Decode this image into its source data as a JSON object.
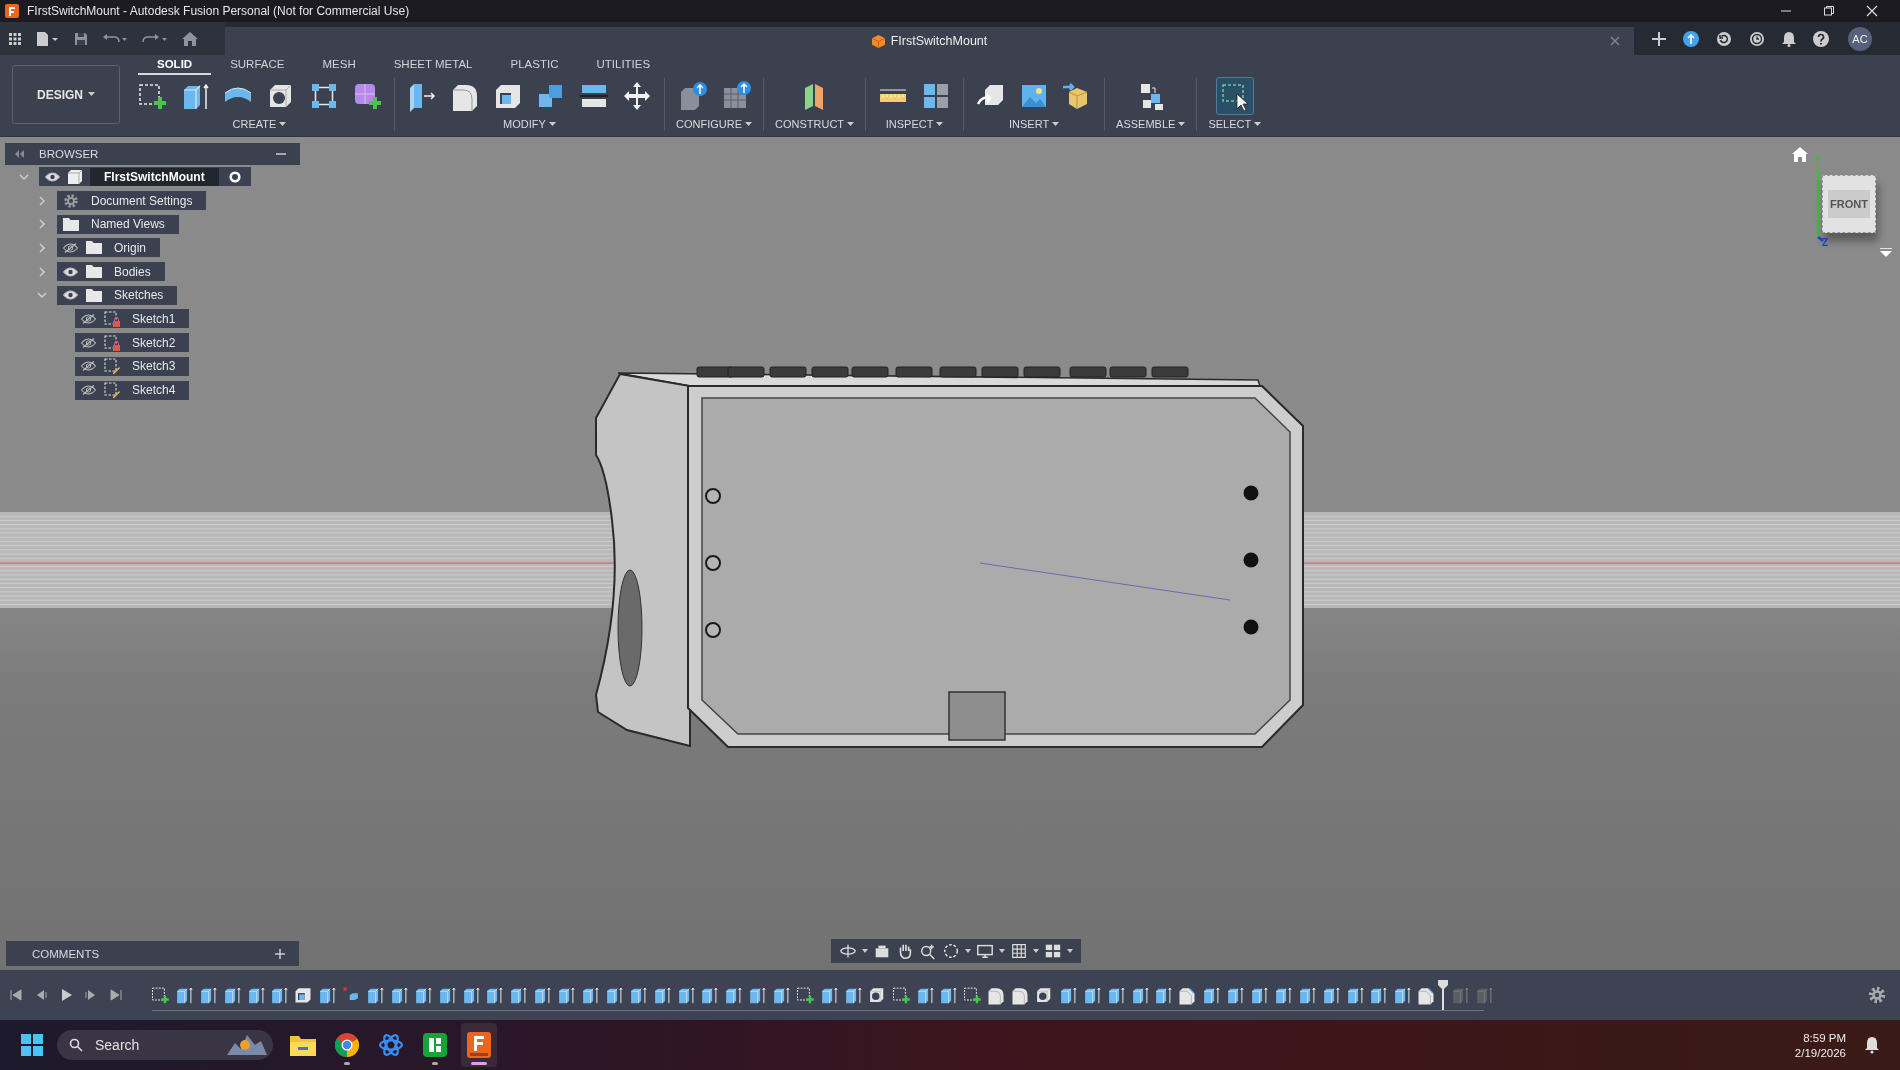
{
  "window": {
    "title": "FIrstSwitchMount - Autodesk Fusion Personal (Not for Commercial Use)"
  },
  "document_tab": {
    "title": "FIrstSwitchMount"
  },
  "account": {
    "initials": "AC"
  },
  "workspace": {
    "label": "DESIGN"
  },
  "tabs": [
    {
      "label": "SOLID",
      "selected": true
    },
    {
      "label": "SURFACE",
      "selected": false
    },
    {
      "label": "MESH",
      "selected": false
    },
    {
      "label": "SHEET METAL",
      "selected": false
    },
    {
      "label": "PLASTIC",
      "selected": false
    },
    {
      "label": "UTILITIES",
      "selected": false
    }
  ],
  "tool_groups": [
    {
      "label": "CREATE",
      "tools": [
        {
          "kind": "sketch",
          "selected": false
        },
        {
          "kind": "extrude",
          "selected": false
        },
        {
          "kind": "revolve",
          "selected": false
        },
        {
          "kind": "hole",
          "selected": false
        },
        {
          "kind": "pattern",
          "selected": false
        },
        {
          "kind": "form",
          "selected": false
        }
      ]
    },
    {
      "label": "MODIFY",
      "tools": [
        {
          "kind": "presspull",
          "selected": false
        },
        {
          "kind": "fillet",
          "selected": false
        },
        {
          "kind": "shell",
          "selected": false
        },
        {
          "kind": "combine",
          "selected": false
        },
        {
          "kind": "split",
          "selected": false
        },
        {
          "kind": "move",
          "selected": false
        }
      ]
    },
    {
      "label": "CONFIGURE",
      "tools": [
        {
          "kind": "parameters",
          "selected": false
        },
        {
          "kind": "table",
          "selected": false
        }
      ]
    },
    {
      "label": "CONSTRUCT",
      "tools": [
        {
          "kind": "plane",
          "selected": false
        }
      ]
    },
    {
      "label": "INSPECT",
      "tools": [
        {
          "kind": "measure",
          "selected": false
        },
        {
          "kind": "interference",
          "selected": false
        }
      ]
    },
    {
      "label": "INSERT",
      "tools": [
        {
          "kind": "derive",
          "selected": false
        },
        {
          "kind": "image",
          "selected": false
        },
        {
          "kind": "mesh",
          "selected": false
        }
      ]
    },
    {
      "label": "ASSEMBLE",
      "tools": [
        {
          "kind": "joint",
          "selected": false
        }
      ]
    },
    {
      "label": "SELECT",
      "tools": [
        {
          "kind": "select",
          "selected": true
        }
      ]
    }
  ],
  "browser": {
    "title": "BROWSER",
    "items": [
      {
        "label": "FIrstSwitchMount",
        "kind": "component",
        "visible": true,
        "expanded": true,
        "children": [
          {
            "label": "Document Settings",
            "kind": "settings",
            "expanded": false
          },
          {
            "label": "Named Views",
            "kind": "folder",
            "expanded": false
          },
          {
            "label": "Origin",
            "kind": "folder",
            "visible": false,
            "expanded": false
          },
          {
            "label": "Bodies",
            "kind": "folder",
            "visible": true,
            "expanded": false
          },
          {
            "label": "Sketches",
            "kind": "folder",
            "visible": true,
            "expanded": true,
            "children": [
              {
                "label": "Sketch1",
                "kind": "sketch",
                "visible": false,
                "locked": true
              },
              {
                "label": "Sketch2",
                "kind": "sketch",
                "visible": false,
                "locked": true
              },
              {
                "label": "Sketch3",
                "kind": "sketch",
                "visible": false,
                "locked": false
              },
              {
                "label": "Sketch4",
                "kind": "sketch",
                "visible": false,
                "locked": false
              }
            ]
          }
        ]
      }
    ]
  },
  "comments": {
    "title": "COMMENTS"
  },
  "view_cube": {
    "face": "FRONT",
    "axes": [
      "Y",
      "Z"
    ]
  },
  "timeline": {
    "features": [
      {
        "kind": "sketch"
      },
      {
        "kind": "extrude"
      },
      {
        "kind": "extrude"
      },
      {
        "kind": "extrude"
      },
      {
        "kind": "extrude"
      },
      {
        "kind": "extrude"
      },
      {
        "kind": "shell"
      },
      {
        "kind": "extrude"
      },
      {
        "kind": "deleted"
      },
      {
        "kind": "extrude"
      },
      {
        "kind": "extrude"
      },
      {
        "kind": "extrude"
      },
      {
        "kind": "extrude"
      },
      {
        "kind": "extrude"
      },
      {
        "kind": "extrude"
      },
      {
        "kind": "extrude"
      },
      {
        "kind": "extrude"
      },
      {
        "kind": "extrude"
      },
      {
        "kind": "extrude"
      },
      {
        "kind": "extrude"
      },
      {
        "kind": "extrude"
      },
      {
        "kind": "extrude"
      },
      {
        "kind": "extrude"
      },
      {
        "kind": "extrude"
      },
      {
        "kind": "extrude"
      },
      {
        "kind": "extrude"
      },
      {
        "kind": "extrude"
      },
      {
        "kind": "sketch"
      },
      {
        "kind": "extrude"
      },
      {
        "kind": "extrude"
      },
      {
        "kind": "hole"
      },
      {
        "kind": "sketch"
      },
      {
        "kind": "extrude"
      },
      {
        "kind": "extrude"
      },
      {
        "kind": "sketch"
      },
      {
        "kind": "fillet"
      },
      {
        "kind": "fillet"
      },
      {
        "kind": "hole"
      },
      {
        "kind": "extrude"
      },
      {
        "kind": "extrude"
      },
      {
        "kind": "extrude"
      },
      {
        "kind": "extrude"
      },
      {
        "kind": "extrude"
      },
      {
        "kind": "chamfer"
      },
      {
        "kind": "extrude"
      },
      {
        "kind": "extrude"
      },
      {
        "kind": "extrude"
      },
      {
        "kind": "extrude"
      },
      {
        "kind": "extrude"
      },
      {
        "kind": "extrude"
      },
      {
        "kind": "extrude"
      },
      {
        "kind": "extrude"
      },
      {
        "kind": "extrude"
      },
      {
        "kind": "chamfer"
      }
    ],
    "rolled_back": [
      {
        "kind": "extrude"
      },
      {
        "kind": "extrude"
      }
    ]
  },
  "taskbar": {
    "search": {
      "placeholder": "Search"
    },
    "apps": [
      {
        "kind": "folder",
        "running": false,
        "active": false
      },
      {
        "kind": "chrome",
        "running": true,
        "active": false
      },
      {
        "kind": "atom",
        "running": false,
        "active": false
      },
      {
        "kind": "tiles",
        "running": true,
        "active": false
      },
      {
        "kind": "fusion",
        "running": true,
        "active": true
      }
    ],
    "time": "8:59 PM",
    "date": "2/19/2026"
  }
}
